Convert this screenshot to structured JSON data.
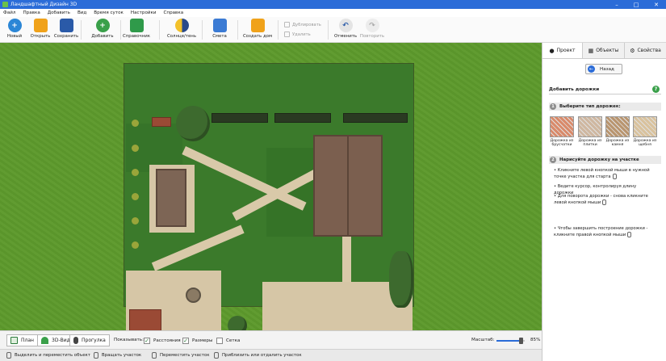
{
  "window": {
    "title": "Ландшафтный Дизайн 3D",
    "minimize_icon": "minimize-icon",
    "maximize_icon": "maximize-icon",
    "close_icon": "close-icon"
  },
  "menu": [
    "Файл",
    "Правка",
    "Добавить",
    "Вид",
    "Время суток",
    "Настройки",
    "Справка"
  ],
  "toolbar": {
    "new": "Новый",
    "open": "Открыть",
    "save": "Сохранить",
    "add": "Добавить",
    "reference": "Справочник",
    "sun_shade": "Солнце/тень",
    "estimate": "Смета",
    "create_house": "Создать дом",
    "duplicate": "Дублировать",
    "delete": "Удалить",
    "undo": "Отменить",
    "redo": "Повторить"
  },
  "colors": {
    "accent": "#2b6cd8",
    "grass": "#5d9a2c",
    "plot": "#3b7a2b",
    "paving": "#d6c6a6",
    "roof": "#7b5f4f",
    "red_roof": "#9a4a35"
  },
  "panel": {
    "tabs": [
      "Проект",
      "Объекты",
      "Свойства"
    ],
    "back": "Назад",
    "section_title": "Добавить дорожки",
    "help": "?",
    "step1": {
      "num": "1",
      "title": "Выберите тип дорожек:"
    },
    "path_types": [
      {
        "label": "Дорожка из брусчатки",
        "color": "#d98a6a"
      },
      {
        "label": "Дорожка из плитки",
        "color": "#cfb7a0"
      },
      {
        "label": "Дорожка из камня",
        "color": "#b9956f"
      },
      {
        "label": "Дорожка из щебня",
        "color": "#d9c29d"
      }
    ],
    "step2": {
      "num": "2",
      "title": "Нарисуйте дорожку на участке"
    },
    "instructions": [
      "Кликните левой кнопкой мыши в нужной точке участка для старта",
      "Ведите курсор, контролируя длину дорожки",
      "Для поворота дорожки - снова кликните левой кнопкой мыши",
      "Чтобы завершить построение дорожки - кликните правой кнопкой мыши"
    ]
  },
  "view": {
    "modes": [
      "План",
      "3D-Вид",
      "Прогулка"
    ],
    "show_label": "Показывать:",
    "show_options": [
      {
        "label": "Расстояния",
        "checked": true
      },
      {
        "label": "Размеры",
        "checked": true
      },
      {
        "label": "Сетка",
        "checked": false
      }
    ],
    "zoom_label": "Масштаб:",
    "zoom_value": "85%",
    "zoom_fraction": 0.85
  },
  "status": [
    "Выделить и переместить объект",
    "Вращать участок",
    "Переместить участок",
    "Приблизить или отдалить участок"
  ]
}
